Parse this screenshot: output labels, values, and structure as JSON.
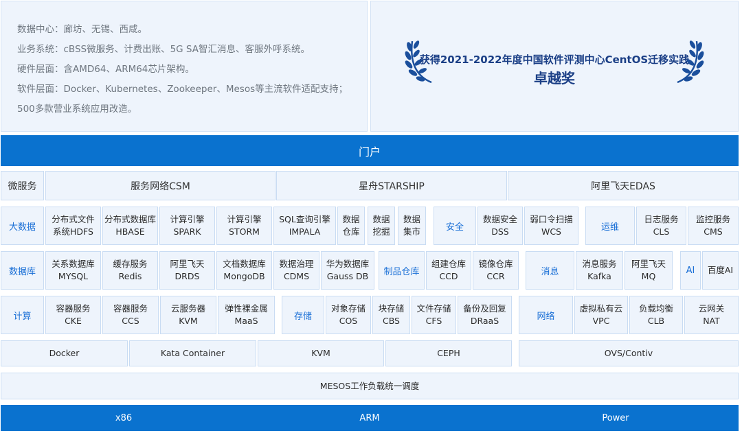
{
  "info": {
    "lines": [
      "数据中心：廊坊、无锡、西咸。",
      "业务系统：cBSS微服务、计费出账、5G SA智汇消息、客服外呼系统。",
      "硬件层面：含AMD64、ARM64芯片架构。",
      "软件层面：Docker、Kubernetes、Zookeeper、Mesos等主流软件适配支持；",
      "500多款营业系统应用改造。"
    ]
  },
  "award": {
    "line1": "获得2021-2022年度中国软件评测中心CentOS迁移实践",
    "line2": "卓越奖"
  },
  "portal": {
    "label": "门户"
  },
  "microservice": {
    "category": "微服务",
    "items": [
      "服务网络CSM",
      "星舟STARSHIP",
      "阿里飞天EDAS"
    ]
  },
  "bigdata": {
    "category": "大数据",
    "items": [
      [
        "分布式文件",
        "系统HDFS"
      ],
      [
        "分布式数据库",
        "HBASE"
      ],
      [
        "计算引擎",
        "SPARK"
      ],
      [
        "计算引擎",
        "STORM"
      ],
      [
        "SQL查询引擎",
        "IMPALA"
      ],
      [
        "数据",
        "仓库"
      ],
      [
        "数据",
        "挖掘"
      ],
      [
        "数据",
        "集市"
      ]
    ]
  },
  "security": {
    "category": "安全",
    "items": [
      [
        "数据安全",
        "DSS"
      ],
      [
        "弱口令扫描",
        "WCS"
      ]
    ]
  },
  "ops": {
    "category": "运维",
    "items": [
      [
        "日志服务",
        "CLS"
      ],
      [
        "监控服务",
        "CMS"
      ]
    ]
  },
  "database": {
    "category": "数据库",
    "items": [
      [
        "关系数据库",
        "MYSQL"
      ],
      [
        "缓存服务",
        "Redis"
      ],
      [
        "阿里飞天",
        "DRDS"
      ],
      [
        "文档数据库",
        "MongoDB"
      ],
      [
        "数据治理",
        "CDMS"
      ],
      [
        "华为数据库",
        "Gauss DB"
      ]
    ]
  },
  "artifact": {
    "category": "制品仓库",
    "items": [
      [
        "组建仓库",
        "CCD"
      ],
      [
        "镜像仓库",
        "CCR"
      ]
    ]
  },
  "message": {
    "category": "消息",
    "items": [
      [
        "消息服务",
        "Kafka"
      ],
      [
        "阿里飞天",
        "MQ"
      ]
    ]
  },
  "ai": {
    "category": "AI",
    "item": "百度AI"
  },
  "compute": {
    "category": "计算",
    "items": [
      [
        "容器服务",
        "CKE"
      ],
      [
        "容器服务",
        "CCS"
      ],
      [
        "云服务器",
        "KVM"
      ],
      [
        "弹性裸金属",
        "MaaS"
      ]
    ]
  },
  "storage": {
    "category": "存储",
    "items": [
      [
        "对象存储",
        "COS"
      ],
      [
        "块存储",
        "CBS"
      ],
      [
        "文件存储",
        "CFS"
      ],
      [
        "备份及回复",
        "DRaaS"
      ]
    ]
  },
  "network": {
    "category": "网络",
    "items": [
      [
        "虚拟私有云",
        "VPC"
      ],
      [
        "负载均衡",
        "CLB"
      ],
      [
        "云网关",
        "NAT"
      ]
    ]
  },
  "virtualization": {
    "items": [
      "Docker",
      "Kata Container",
      "KVM",
      "CEPH",
      "OVS/Contiv"
    ]
  },
  "scheduler": {
    "label": "MESOS工作负载统一调度"
  },
  "hardware": {
    "items": [
      "x86",
      "ARM",
      "Power"
    ]
  },
  "colors": {
    "primary": "#0a72cf",
    "panel": "#eef4fc",
    "border": "#c9dcf3",
    "category_text": "#1a6fd6"
  }
}
